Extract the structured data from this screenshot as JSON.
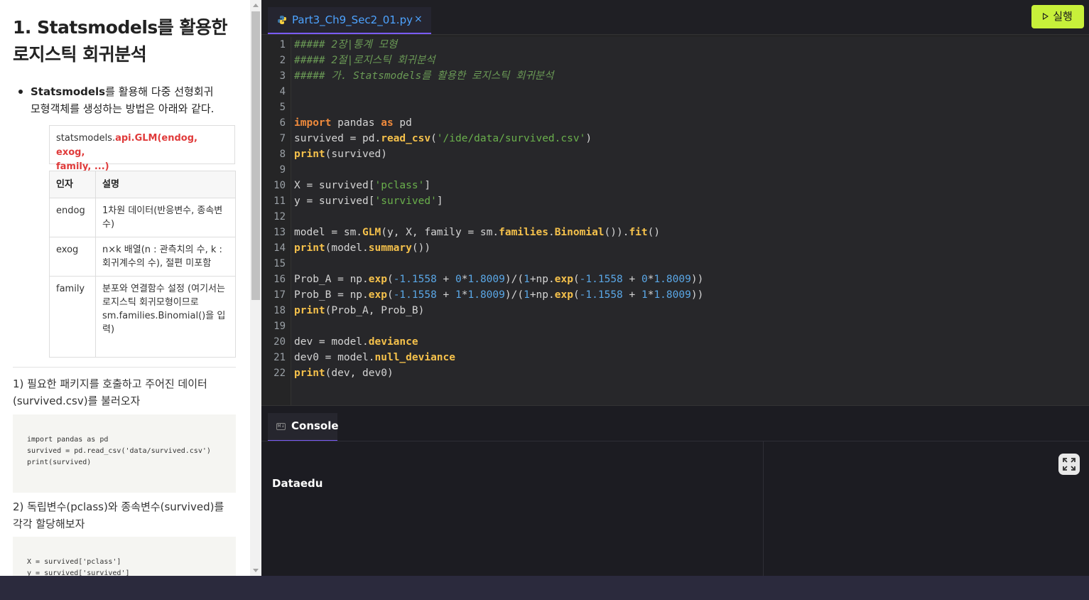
{
  "lesson": {
    "title_line1": "1. Statsmodels를 활용한",
    "title_line2": "로지스틱 회귀분석",
    "bullet_bold": "Statsmodels",
    "bullet_line1_rest": "를 활용해 다중 선형회귀",
    "bullet_line2": "모형객체를 생성하는 방법은 아래와 같다.",
    "signature_prefix": "statsmodels.",
    "signature_red_line1": "api.GLM(endog, exog,",
    "signature_red_line2": "family, ...)",
    "table_headers": [
      "인자",
      "설명"
    ],
    "table_rows": [
      {
        "arg": "endog",
        "desc": "1차원 데이터(반응변수, 종속변수)"
      },
      {
        "arg": "exog",
        "desc": "n×k 배열(n : 관측치의 수, k : 회귀계수의 수), 절편 미포함"
      },
      {
        "arg": "family",
        "desc": "분포와 연결함수 설정 (여기서는 로지스틱 회귀모형이므로 sm.families.Binomial()을 입력)"
      }
    ],
    "step1_line1": "1) 필요한 패키지를 호출하고 주어진 데이터",
    "step1_line2": "(survived.csv)를 불러오자",
    "step1_code": "import pandas as pd\nsurvived = pd.read_csv('data/survived.csv')\nprint(survived)",
    "step2_line1": "2) 독립변수(pclass)와 종속변수(survived)를",
    "step2_line2": "각각 할당해보자",
    "step2_code": "X = survived['pclass']\ny = survived['survived']"
  },
  "editor": {
    "file_tab": "Part3_Ch9_Sec2_01.py",
    "close_glyph": "×",
    "run_label": "실행",
    "line_numbers": [
      "1",
      "2",
      "3",
      "4",
      "5",
      "6",
      "7",
      "8",
      "9",
      "10",
      "11",
      "12",
      "13",
      "14",
      "15",
      "16",
      "17",
      "18",
      "19",
      "20",
      "21",
      "22"
    ]
  },
  "console": {
    "tab_label": "Console",
    "icon_text": "M↓",
    "output": "Dataedu"
  },
  "colors": {
    "accent": "#7a5cf5",
    "run_button": "#c7f03a",
    "tab_text": "#4da3ff",
    "keyword": "#ef8a3c",
    "function": "#f5c14b",
    "string": "#6ab04c",
    "comment": "#6a9955",
    "number": "#5aa7e6"
  }
}
